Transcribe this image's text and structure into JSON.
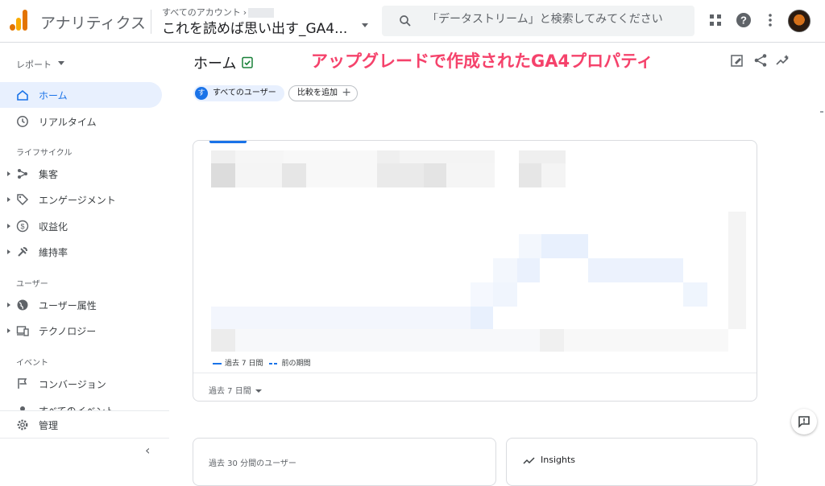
{
  "header": {
    "product_name": "アナリティクス",
    "account_breadcrumb": "すべてのアカウント",
    "property_name": "これを読めば思い出す_GA4...",
    "search_placeholder": "「データストリーム」と検索してみてください"
  },
  "sidebar": {
    "report_label": "レポート",
    "home_label": "ホーム",
    "realtime_label": "リアルタイム",
    "lifecycle_label": "ライフサイクル",
    "acquisition_label": "集客",
    "engagement_label": "エンゲージメント",
    "monetization_label": "収益化",
    "retention_label": "維持率",
    "user_section_label": "ユーザー",
    "user_attributes_label": "ユーザー属性",
    "technology_label": "テクノロジー",
    "event_section_label": "イベント",
    "conversions_label": "コンバージョン",
    "all_events_label": "すべてのイベント",
    "admin_label": "管理"
  },
  "main": {
    "page_title": "ホーム",
    "banner_text": "アップグレードで作成されたGA4プロパティ",
    "users_chip": "すべてのユーザー",
    "users_chip_initial": "す",
    "compare_chip": "比較を追加",
    "legend_current": "過去 7 日間",
    "legend_previous": "前の期間",
    "date_range": "過去 7 日間",
    "realtime_card_title": "過去 30 分間のユーザー",
    "insights_title": "Insights"
  },
  "colors": {
    "accent": "#1a73e8",
    "banner": "#f5426b",
    "active_nav_bg": "#e8f0fe"
  }
}
